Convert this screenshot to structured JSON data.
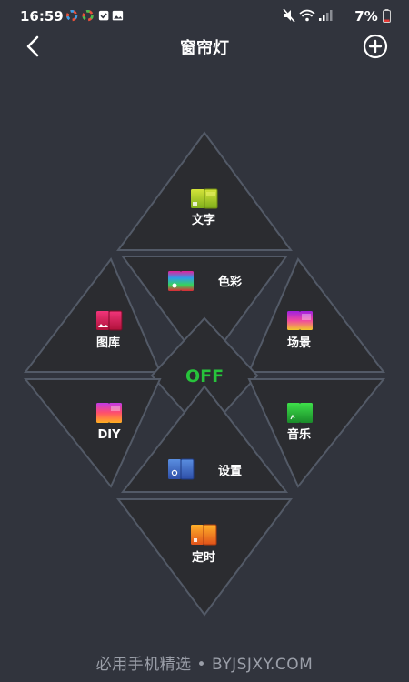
{
  "status_bar": {
    "time": "16:59",
    "battery": "7%"
  },
  "header": {
    "title": "窗帘灯",
    "back_icon": "chevron-left-icon",
    "add_icon": "plus-circle-icon"
  },
  "menu": {
    "text_label": "文字",
    "color_label": "色彩",
    "gallery_label": "图库",
    "scene_label": "场景",
    "power_label": "OFF",
    "diy_label": "DIY",
    "music_label": "音乐",
    "settings_label": "设置",
    "timer_label": "定时"
  },
  "colors": {
    "background": "#31343d",
    "tile": "#2b2c30",
    "tile_border": "#535a67",
    "power_text": "#27c43b"
  },
  "footer": {
    "watermark": "必用手机精选 • BYJSJXY.COM"
  }
}
